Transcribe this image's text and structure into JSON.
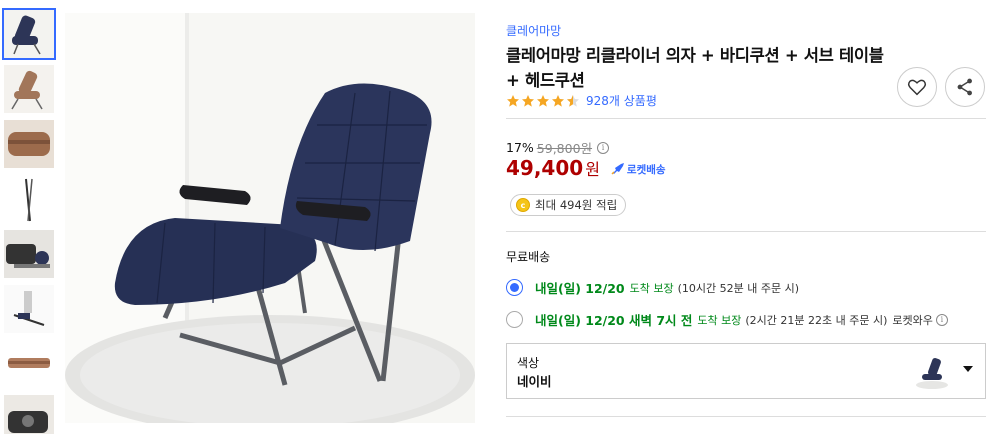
{
  "product": {
    "brand": "클레어마망",
    "title": "클레어마망 리클라이너 의자 + 바디쿠션 + 서브 테이블 + 헤드쿠션",
    "rating": 4.5,
    "review_count": "928개 상품평"
  },
  "price": {
    "discount_rate": "17%",
    "original_price": "59,800원",
    "sale_price": "49,400",
    "sale_unit": "원",
    "rocket_label": "로켓배송",
    "reward": "최대 494원 적립"
  },
  "shipping": {
    "free_label": "무료배송",
    "options": [
      {
        "main": "내일(일) 12/20",
        "guarantee": "도착 보장",
        "cutoff": "(10시간 52분 내 주문 시)",
        "extra": "",
        "selected": true
      },
      {
        "main": "내일(일) 12/20 새벽 7시 전",
        "guarantee": "도착 보장",
        "cutoff": "(2시간 21분 22초 내 주문 시)",
        "extra": "로켓와우",
        "selected": false
      }
    ]
  },
  "option": {
    "label": "색상",
    "value": "네이비"
  },
  "icons": {
    "favorite": "heart-icon",
    "share": "share-icon",
    "rocket": "rocket-icon"
  },
  "colors": {
    "accent": "#346aff",
    "price": "#ae0000",
    "delivery": "#00891a",
    "star": "#f5a623"
  }
}
